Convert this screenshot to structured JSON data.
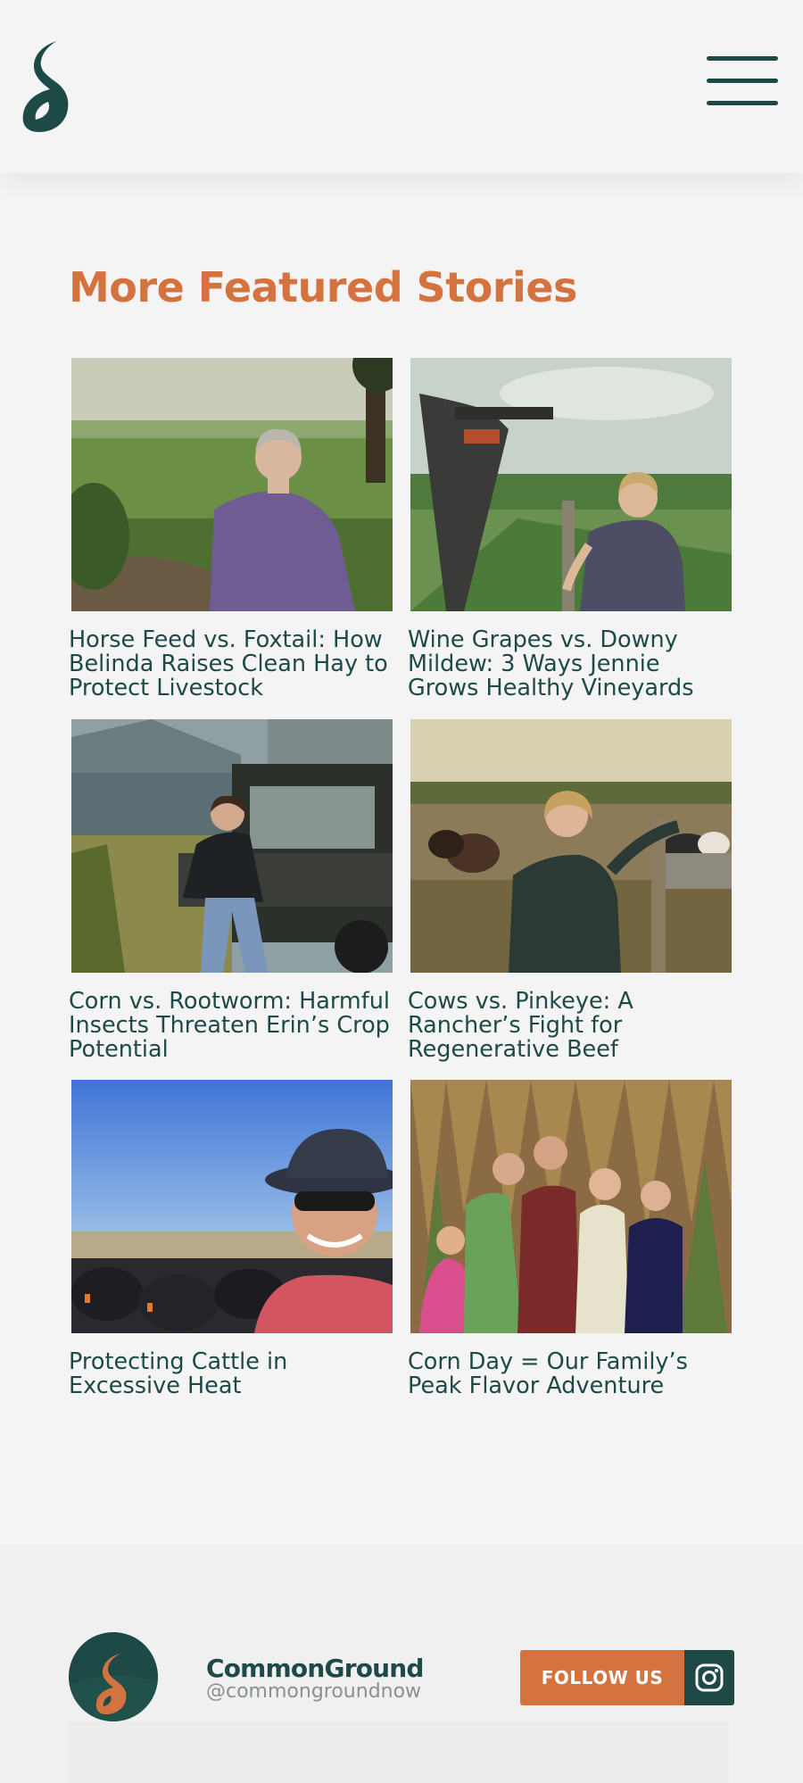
{
  "header": {
    "logo_icon": "commonground-leaf-logo",
    "menu_icon": "hamburger-menu-icon"
  },
  "featured": {
    "title": "More Featured Stories",
    "stories": [
      {
        "title": "Horse Feed vs. Foxtail: How Belinda Raises Clean Hay to Protect Livestock",
        "image": "woman-purple-shirt-hay-field"
      },
      {
        "title": "Wine Grapes vs. Downy Mildew: 3 Ways Jennie Grows Healthy Vineyards",
        "image": "woman-vineyard-sprayer"
      },
      {
        "title": "Corn vs. Rootworm: Harmful Insects Threaten Erin’s Crop Potential",
        "image": "woman-utv-corn-bins"
      },
      {
        "title": "Cows vs. Pinkeye: A Rancher’s Fight for Regenerative Beef",
        "image": "woman-fence-cattle"
      },
      {
        "title": "Protecting Cattle in Excessive Heat",
        "image": "woman-selfie-black-cattle"
      },
      {
        "title": "Corn Day = Our Family’s Peak Flavor Adventure",
        "image": "family-cornfield"
      }
    ]
  },
  "footer": {
    "brand_name": "CommonGround",
    "handle": "@commongroundnow",
    "follow_label": "FOLLOW US",
    "instagram_icon": "instagram-icon"
  },
  "colors": {
    "accent": "#d4733f",
    "brand": "#1d4a47",
    "background": "#f4f4f5"
  }
}
